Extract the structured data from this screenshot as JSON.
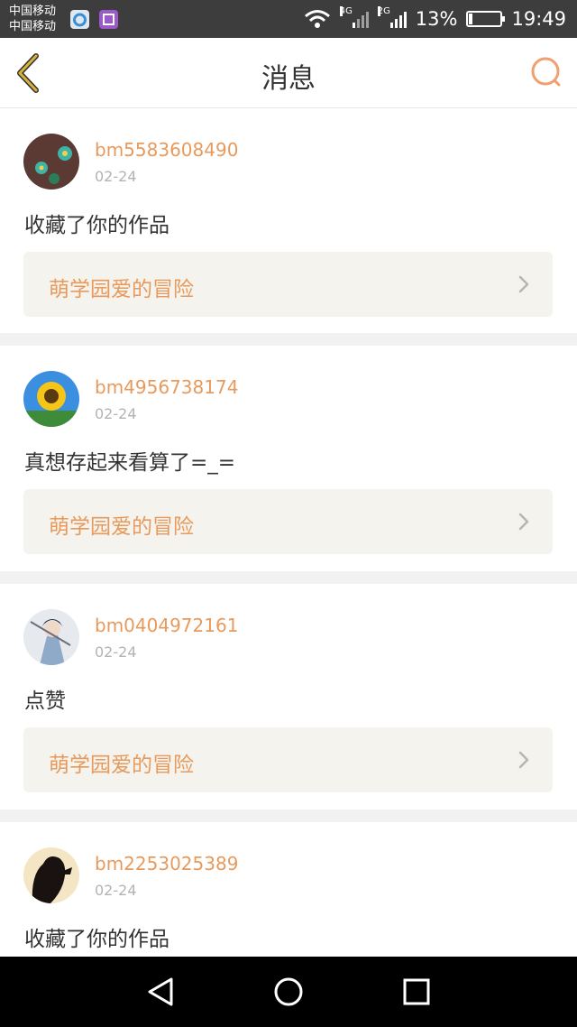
{
  "status_bar": {
    "carrier_1": "中国移动",
    "carrier_2": "中国移动",
    "net_1": "4G",
    "net_2": "2G",
    "battery": "13%",
    "battery_level": 0.13,
    "time": "19:49"
  },
  "header": {
    "title": "消息",
    "back_icon": "chevron-left-icon",
    "search_icon": "search-icon"
  },
  "colors": {
    "accent": "#e89a5c",
    "back_icon": "#d9b23a",
    "text": "#333333",
    "muted": "#b3b3b3",
    "card_link_bg": "#f4f3ed"
  },
  "messages": [
    {
      "username": "bm5583608490",
      "date": "02-24",
      "text": "收藏了你的作品",
      "work": "萌学园爱的冒险"
    },
    {
      "username": "bm4956738174",
      "date": "02-24",
      "text": "真想存起来看算了=_=",
      "work": "萌学园爱的冒险"
    },
    {
      "username": "bm0404972161",
      "date": "02-24",
      "text": "点赞",
      "work": "萌学园爱的冒险"
    },
    {
      "username": "bm2253025389",
      "date": "02-24",
      "text": "收藏了你的作品",
      "work": ""
    }
  ]
}
